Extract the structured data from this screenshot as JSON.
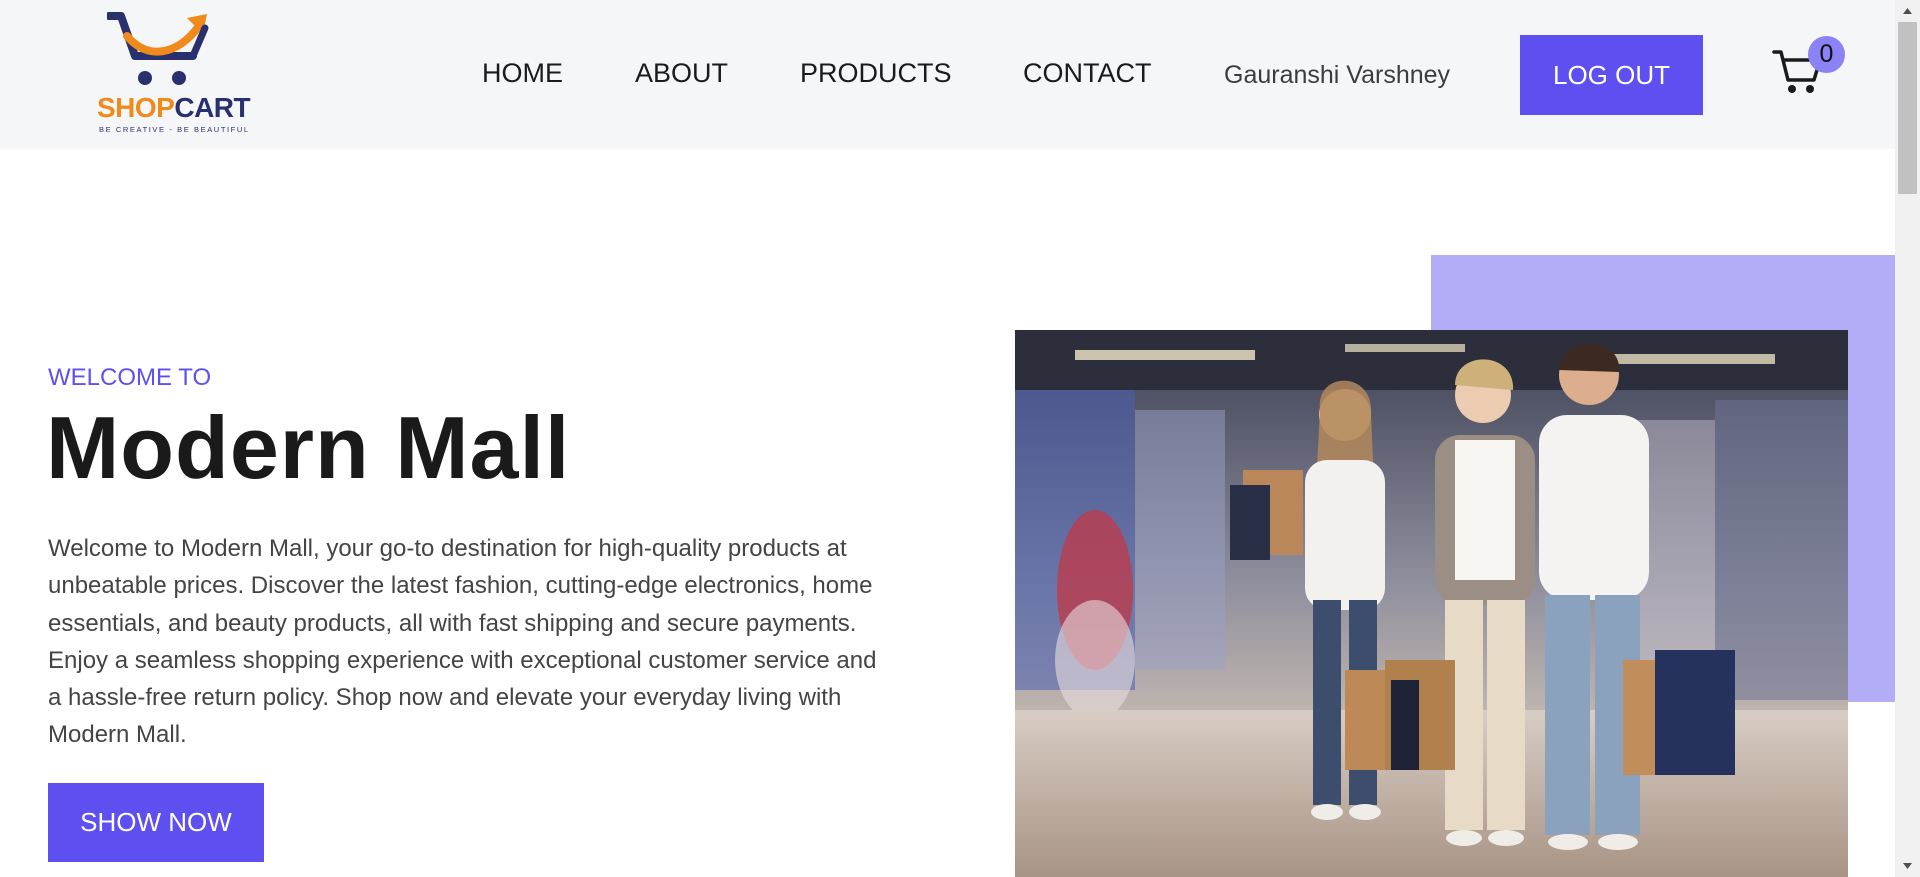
{
  "brand": {
    "name_part1": "SHOP",
    "name_part2": "CART",
    "tagline": "BE CREATIVE - BE BEAUTIFUL",
    "colors": {
      "orange": "#f08a1c",
      "navy": "#29306e"
    },
    "icon": "shopping-cart-arrow-logo"
  },
  "nav": {
    "items": [
      {
        "label": "HOME"
      },
      {
        "label": "ABOUT"
      },
      {
        "label": "PRODUCTS"
      },
      {
        "label": "CONTACT"
      }
    ],
    "user_name": "Gauranshi Varshney",
    "logout_label": "LOG OUT",
    "cart_count": "0",
    "cart_icon": "cart-icon"
  },
  "hero": {
    "eyebrow": "WELCOME TO",
    "title": "Modern Mall",
    "description": "Welcome to Modern Mall, your go-to destination for high-quality products at unbeatable prices. Discover the latest fashion, cutting-edge electronics, home essentials, and beauty products, all with fast shipping and secure payments. Enjoy a seamless shopping experience with exceptional customer service and a hassle-free return policy. Shop now and elevate your everyday living with Modern Mall.",
    "cta_label": "SHOW NOW",
    "image_subject": "family-shopping-in-mall-photo"
  },
  "colors": {
    "accent": "#5e50f0",
    "accent_light": "#b3acf6",
    "badge": "#8a82f5",
    "header_bg": "#f5f6f8"
  }
}
